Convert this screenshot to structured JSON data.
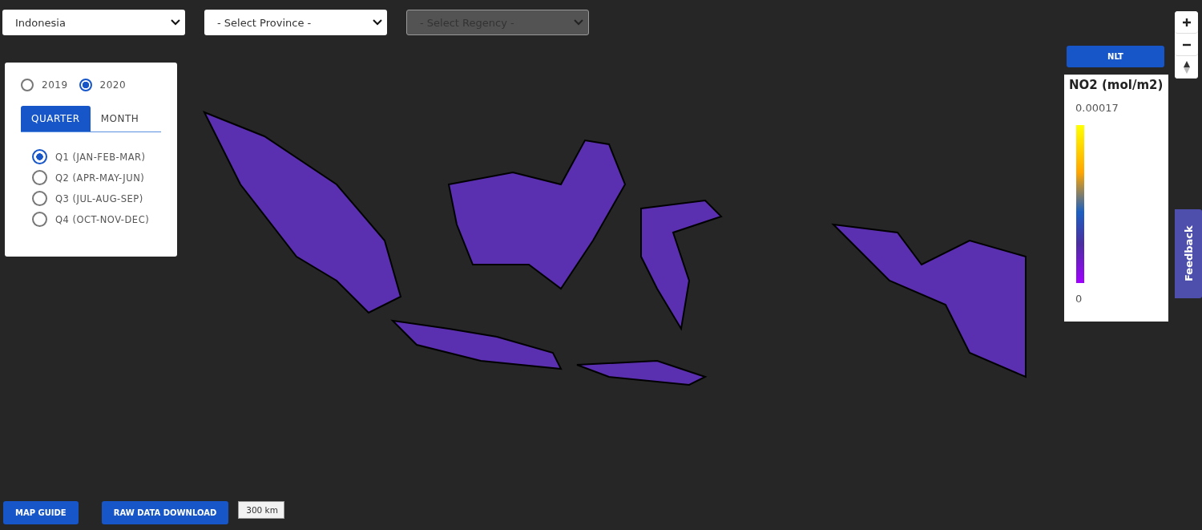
{
  "filters": [
    {
      "value": "Indonesia",
      "disabled": false
    },
    {
      "value": "- Select Province -",
      "disabled": false
    },
    {
      "value": "- Select Regency -",
      "disabled": true
    }
  ],
  "period_panel": {
    "years": [
      {
        "label": "2019",
        "selected": false
      },
      {
        "label": "2020",
        "selected": true
      }
    ],
    "tabs": [
      {
        "label": "QUARTER",
        "selected": true
      },
      {
        "label": "MONTH",
        "selected": false
      }
    ],
    "periods": [
      {
        "label": "Q1 (JAN-FEB-MAR)",
        "selected": true
      },
      {
        "label": "Q2 (APR-MAY-JUN)",
        "selected": false
      },
      {
        "label": "Q3 (JUL-AUG-SEP)",
        "selected": false
      },
      {
        "label": "Q4 (OCT-NOV-DEC)",
        "selected": false
      }
    ]
  },
  "layer_button": "NLT",
  "legend": {
    "title": "NO2 (mol/m2)",
    "max": "0.00017",
    "min": "0"
  },
  "feedback": "Feedback",
  "buttons": [
    "MAP GUIDE",
    "RAW DATA DOWNLOAD"
  ],
  "scale": "300 km"
}
